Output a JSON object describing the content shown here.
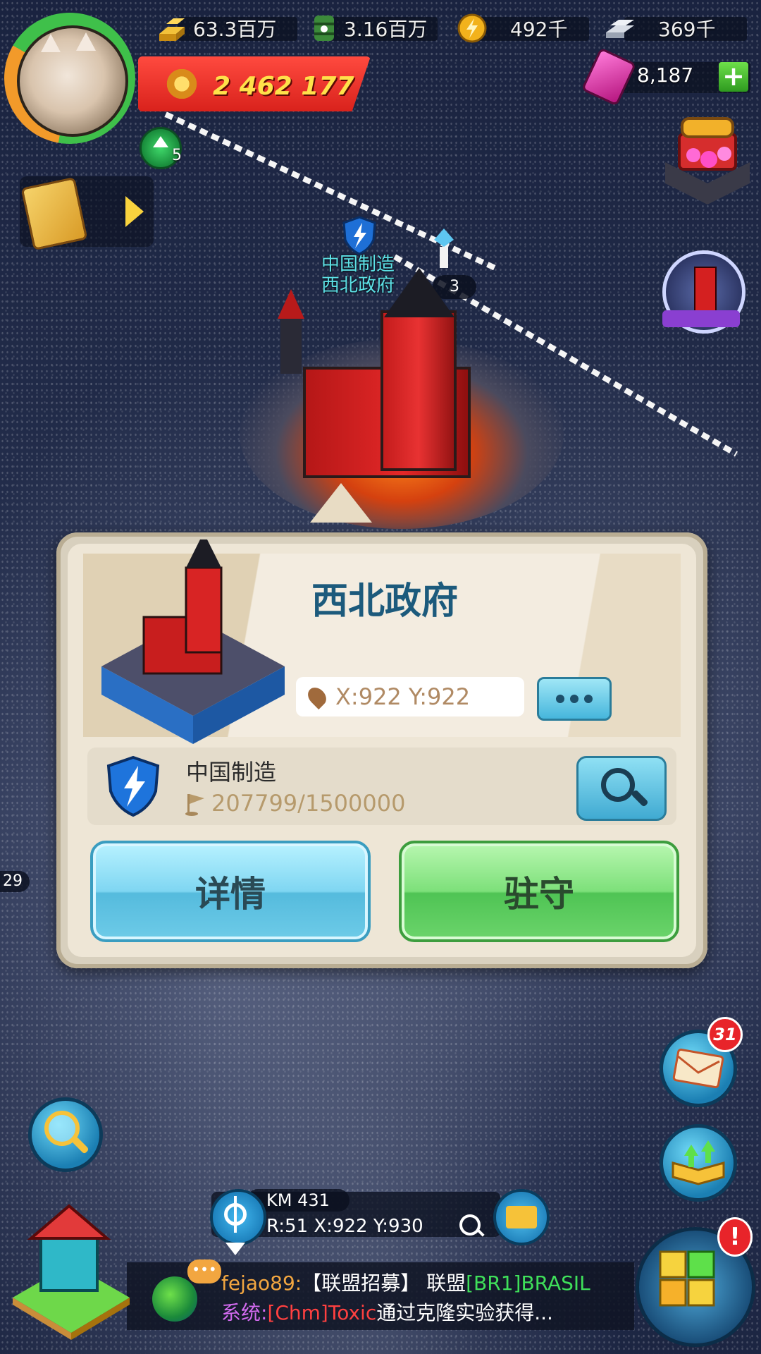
{
  "resources": {
    "gold": "63.3百万",
    "oil": "3.16百万",
    "energy": "492千",
    "steel": "369千"
  },
  "player": {
    "power": "2 462 177",
    "level": "5",
    "gems": "8,187"
  },
  "map": {
    "city_alliance_label": "中国制造",
    "city_name_label": "西北政府",
    "unit_count": "3",
    "side_unit_count": "29"
  },
  "panel": {
    "title": "西北政府",
    "coords": "X:922 Y:922",
    "alliance_name": "中国制造",
    "alliance_progress": "207799/1500000",
    "detail_button": "详情",
    "garrison_button": "驻守"
  },
  "mail": {
    "badge": "31"
  },
  "nav": {
    "km": "KM 431",
    "position": "R:51 X:922 Y:930"
  },
  "chat": {
    "line1_user": "fejao89:",
    "line1_text": "【联盟招募】 联盟",
    "line1_tag": "[BR1]BRASIL",
    "line2_prefix": "系统:",
    "line2_user": "[Chm]Toxic",
    "line2_text": "通过克隆实验获得..."
  },
  "icons": {
    "gold": "gold-bars-icon",
    "oil": "oil-barrel-icon",
    "energy": "energy-bolt-icon",
    "steel": "steel-ingot-icon",
    "gem": "gem-icon",
    "add": "plus-icon",
    "alliance": "shield-lightning-icon",
    "location": "location-pin-icon",
    "more": "more-dots-icon",
    "search": "search-icon",
    "flag": "flag-icon",
    "mail": "mail-icon",
    "upgrade": "upgrade-book-icon",
    "locate": "crosshair-icon",
    "bookmark": "folder-pin-icon",
    "world": "globe-icon",
    "base": "house-icon",
    "events": "puzzle-cube-icon",
    "quest": "quest-clipboard-icon",
    "chest": "treasure-chest-icon"
  },
  "colors": {
    "accent_blue": "#55bbdd",
    "accent_green": "#4fc454",
    "power_banner": "#d9221c",
    "power_text": "#ffe14a",
    "title_text": "#1c5a7c",
    "alliance_label": "#5de0e6"
  }
}
